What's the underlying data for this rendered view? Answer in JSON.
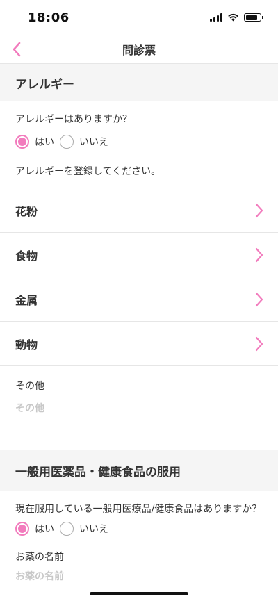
{
  "status_bar": {
    "time": "18:06"
  },
  "nav": {
    "title": "問診票"
  },
  "colors": {
    "accent": "#f27bbd",
    "section_bg": "#f5f5f5",
    "divider": "#e6e6e6"
  },
  "allergy": {
    "section_title": "アレルギー",
    "question": "アレルギーはありますか？",
    "yes_label": "はい",
    "no_label": "いいえ",
    "selected": "yes",
    "hint": "アレルギーを登録してください。",
    "items": [
      {
        "label": "花粉"
      },
      {
        "label": "食物"
      },
      {
        "label": "金属"
      },
      {
        "label": "動物"
      }
    ],
    "other_label": "その他",
    "other_placeholder": "その他"
  },
  "otc": {
    "section_title": "一般用医薬品・健康食品の服用",
    "question": "現在服用している一般用医療品/健康食品はありますか？",
    "yes_label": "はい",
    "no_label": "いいえ",
    "selected": "yes",
    "medicine_label": "お薬の名前",
    "medicine_placeholder": "お薬の名前"
  }
}
